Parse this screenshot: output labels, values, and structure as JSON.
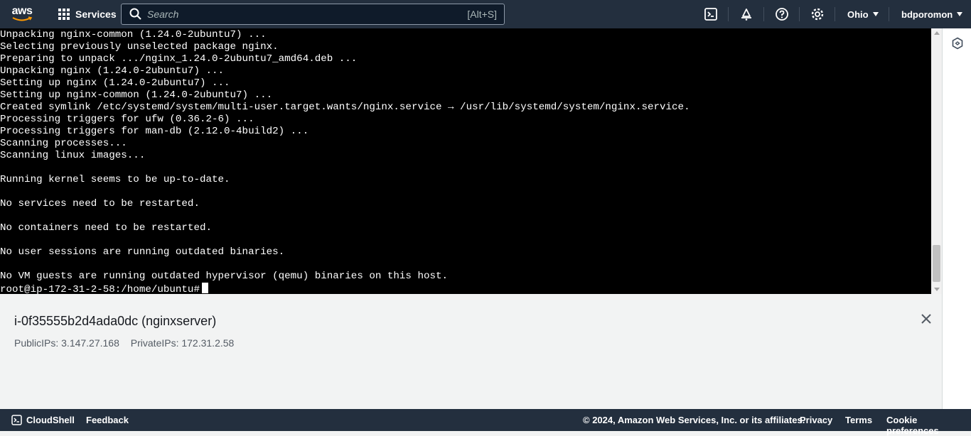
{
  "nav": {
    "logo_text": "aws",
    "services_label": "Services",
    "search_placeholder": "Search",
    "search_shortcut": "[Alt+S]",
    "region": "Ohio",
    "account": "bdporomon",
    "icons": [
      "cloudshell-icon",
      "bell-icon",
      "help-icon",
      "gear-icon"
    ]
  },
  "terminal": {
    "lines": [
      "Unpacking nginx-common (1.24.0-2ubuntu7) ...",
      "Selecting previously unselected package nginx.",
      "Preparing to unpack .../nginx_1.24.0-2ubuntu7_amd64.deb ...",
      "Unpacking nginx (1.24.0-2ubuntu7) ...",
      "Setting up nginx (1.24.0-2ubuntu7) ...",
      "Setting up nginx-common (1.24.0-2ubuntu7) ...",
      "Created symlink /etc/systemd/system/multi-user.target.wants/nginx.service → /usr/lib/systemd/system/nginx.service.",
      "Processing triggers for ufw (0.36.2-6) ...",
      "Processing triggers for man-db (2.12.0-4build2) ...",
      "Scanning processes...",
      "Scanning linux images...",
      "",
      "Running kernel seems to be up-to-date.",
      "",
      "No services need to be restarted.",
      "",
      "No containers need to be restarted.",
      "",
      "No user sessions are running outdated binaries.",
      "",
      "No VM guests are running outdated hypervisor (qemu) binaries on this host."
    ],
    "prompt": "root@ip-172-31-2-58:/home/ubuntu#"
  },
  "instance": {
    "title": "i-0f35555b2d4ada0dc (nginxserver)",
    "public_ips": "PublicIPs: 3.147.27.168",
    "private_ips": "PrivateIPs: 172.31.2.58"
  },
  "footer": {
    "cloudshell": "CloudShell",
    "feedback": "Feedback",
    "copyright": "© 2024, Amazon Web Services, Inc. or its affiliates.",
    "privacy": "Privacy",
    "terms": "Terms",
    "cookies": "Cookie preferences"
  },
  "colors": {
    "nav_bg": "#232f3e",
    "terminal_bg": "#000000",
    "terminal_fg": "#ffffff",
    "panel_bg": "#f2f3f3"
  }
}
